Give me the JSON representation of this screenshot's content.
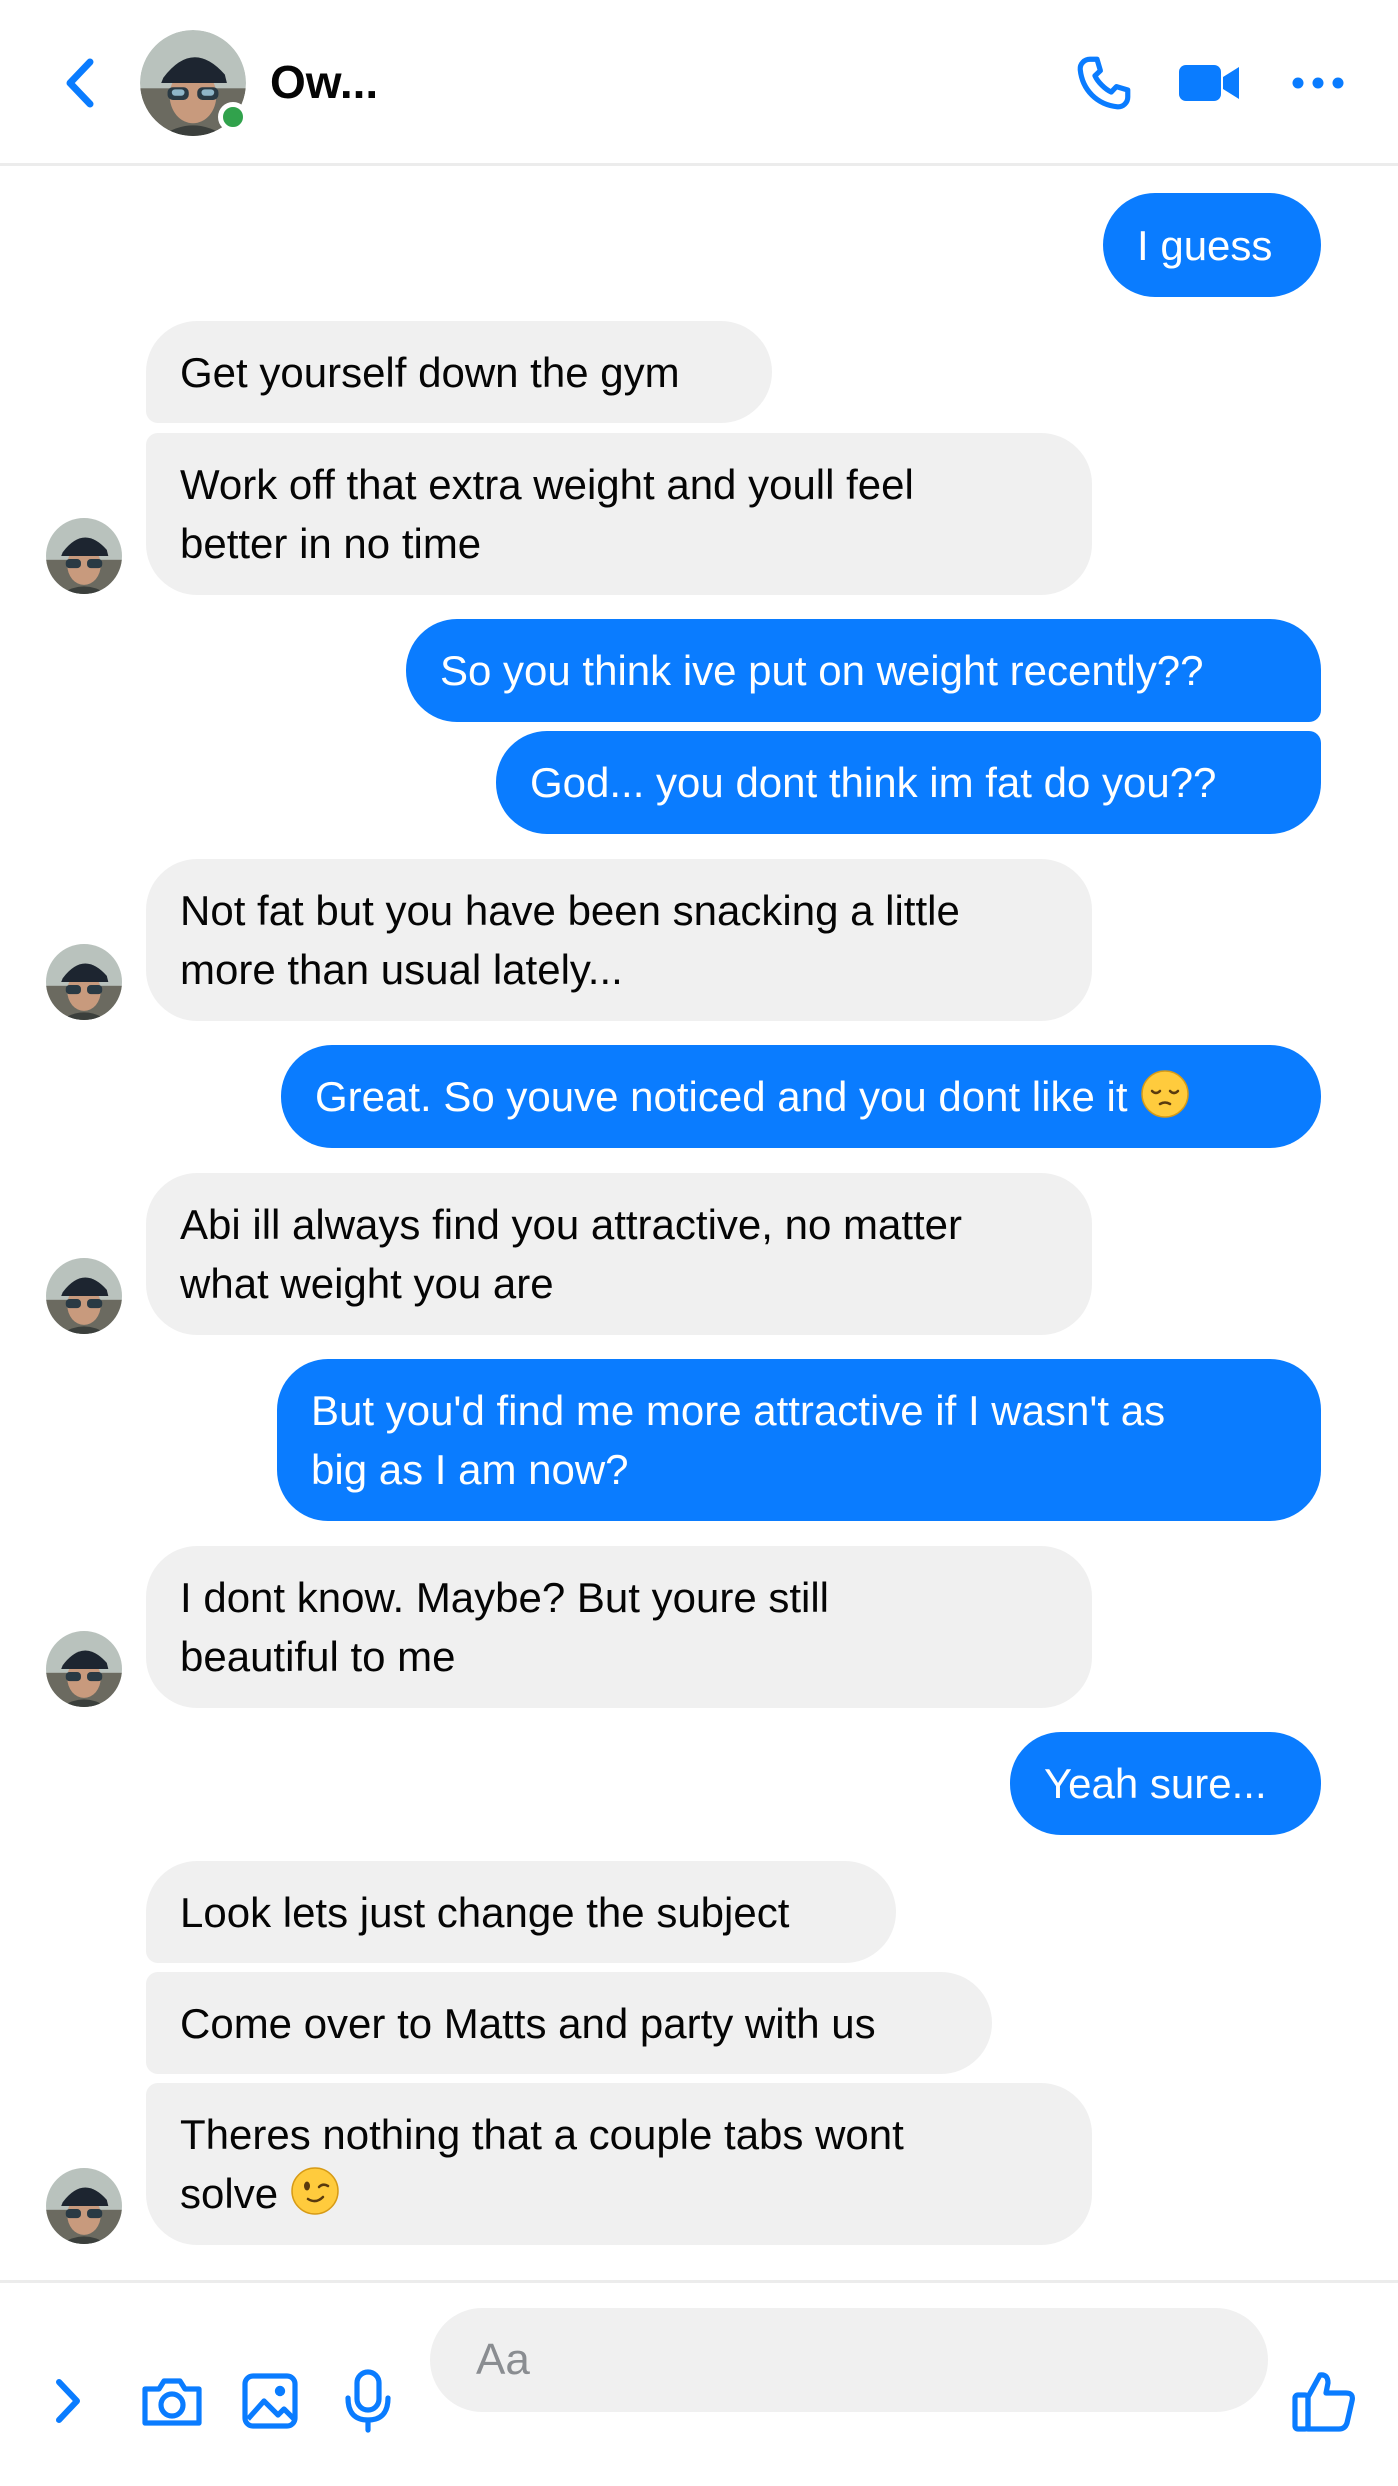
{
  "header": {
    "contact_name": "Ow...",
    "icons": {
      "back": "chevron-left-icon",
      "call": "phone-icon",
      "video": "video-camera-icon",
      "more": "more-horizontal-icon"
    },
    "online": true
  },
  "messages": [
    {
      "direction": "out",
      "text": "I guess"
    },
    {
      "direction": "in",
      "text": "Get yourself down the gym"
    },
    {
      "direction": "in",
      "lines": [
        "Work off that extra weight and youll feel",
        "better in no time"
      ]
    },
    {
      "direction": "out",
      "text": "So you think ive put on weight recently??"
    },
    {
      "direction": "out",
      "text": "God... you dont think im fat do you??"
    },
    {
      "direction": "in",
      "lines": [
        "Not fat but you have been snacking a little",
        "more than usual lately..."
      ]
    },
    {
      "direction": "out",
      "text": "Great. So youve noticed and you dont like it",
      "emoji": "pensive-face-emoji"
    },
    {
      "direction": "in",
      "lines": [
        "Abi ill always find you attractive, no matter",
        "what weight you are"
      ]
    },
    {
      "direction": "out",
      "lines": [
        "But you'd find me more attractive if I wasn't as",
        "big as I am now?"
      ]
    },
    {
      "direction": "in",
      "lines": [
        "I dont know. Maybe? But youre still",
        "beautiful to me"
      ]
    },
    {
      "direction": "out",
      "text": "Yeah sure..."
    },
    {
      "direction": "in",
      "text": "Look lets just change the subject"
    },
    {
      "direction": "in",
      "text": "Come over to Matts and party with us"
    },
    {
      "direction": "in",
      "lines": [
        "Theres nothing that a couple tabs wont",
        "solve"
      ],
      "emoji": "winking-face-emoji"
    }
  ],
  "composer": {
    "placeholder": "Aa",
    "icons": {
      "expand": "chevron-right-icon",
      "camera": "camera-icon",
      "gallery": "image-icon",
      "voice": "microphone-icon",
      "like": "thumbs-up-icon"
    }
  },
  "colors": {
    "accent": "#0a7cff",
    "incoming_bubble": "#f0f0f0",
    "online": "#31a24c"
  }
}
